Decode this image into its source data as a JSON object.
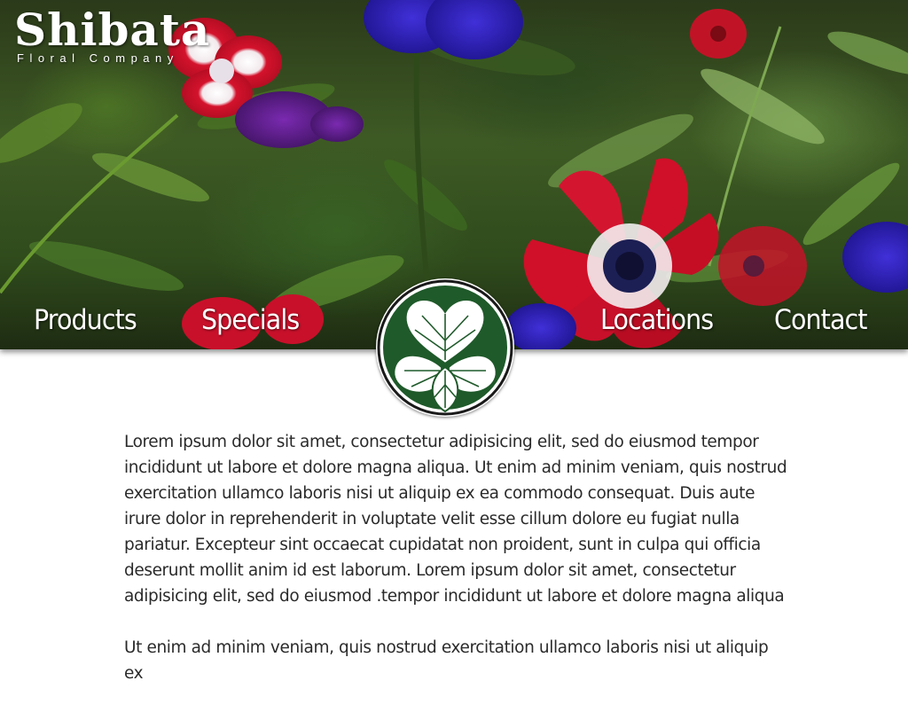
{
  "brand": {
    "name": "Shibata",
    "tagline": "Floral Company"
  },
  "nav": {
    "products": "Products",
    "specials": "Specials",
    "locations": "Locations",
    "contact": "Contact"
  },
  "content": {
    "paragraphs": [
      "Lorem ipsum dolor sit amet, consectetur adipisicing elit, sed do eiusmod tempor incididunt ut labore et dolore magna aliqua. Ut enim ad minim veniam, quis nostrud exercitation ullamco laboris nisi ut aliquip ex ea commodo consequat. Duis aute irure dolor in reprehenderit in voluptate velit esse cillum dolore eu fugiat nulla pariatur. Excepteur sint occaecat cupidatat non proident, sunt in culpa qui officia deserunt mollit anim id est laborum. Lorem ipsum dolor sit amet, consectetur adipisicing elit, sed do eiusmod .tempor incididunt ut labore et dolore magna aliqua",
      "Ut enim ad minim veniam, quis nostrud exercitation ullamco laboris nisi ut aliquip ex"
    ]
  },
  "colors": {
    "emblem_green": "#1f5a2a",
    "anemone_red": "#c8102e",
    "anemone_blue": "#2a1fb8",
    "anemone_purple": "#5a1a8a"
  },
  "icons": {
    "emblem": "hollyhock-crest-icon"
  }
}
